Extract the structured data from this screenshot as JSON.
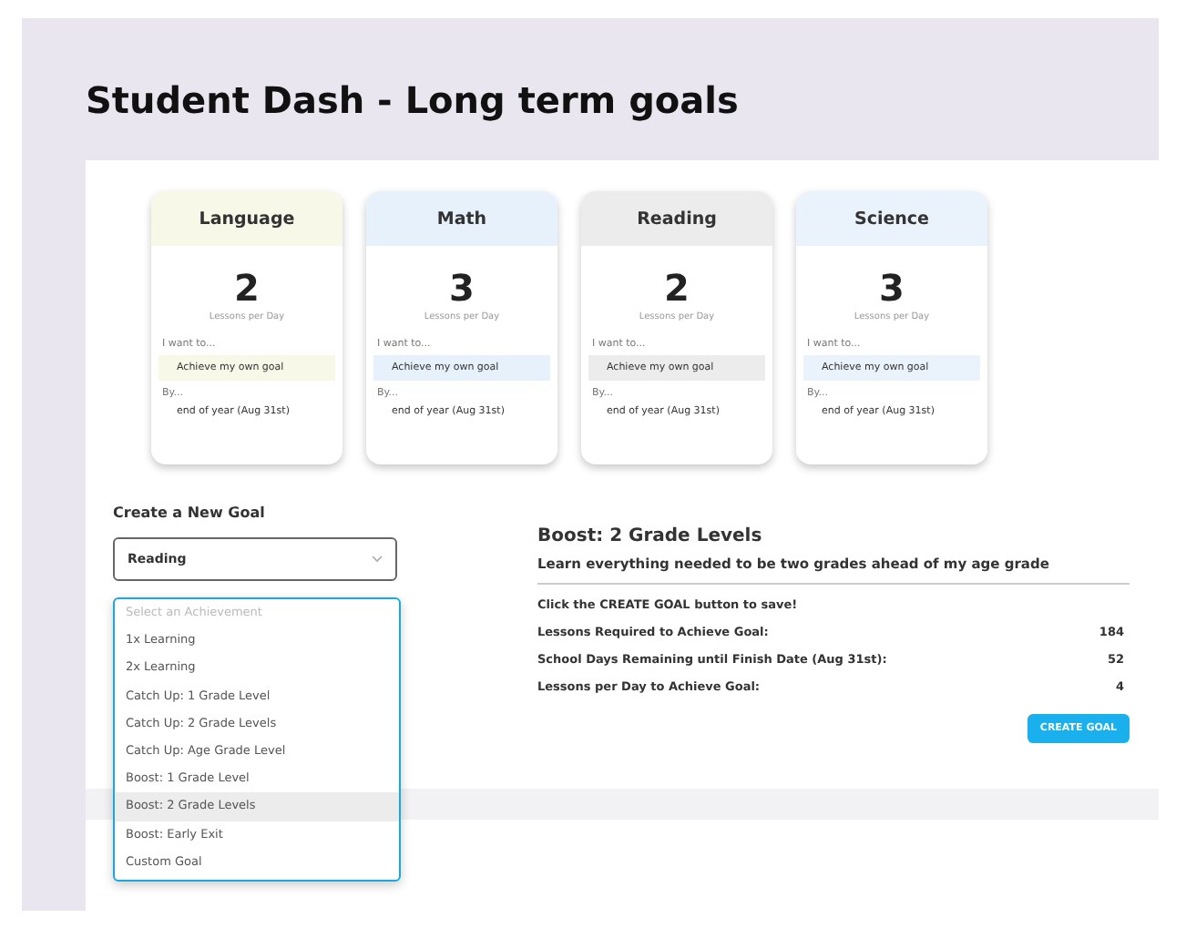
{
  "title": "Student Dash - Long term goals",
  "subjects": [
    {
      "name": "Language",
      "color": "#f8f8e8",
      "count": "2",
      "unit": "Lessons per Day",
      "want_label": "I want to...",
      "goal": "Achieve my own goal",
      "by_label": "By...",
      "deadline": "end of year (Aug 31st)"
    },
    {
      "name": "Math",
      "color": "#e6f1fb",
      "count": "3",
      "unit": "Lessons per Day",
      "want_label": "I want to...",
      "goal": "Achieve my own goal",
      "by_label": "By...",
      "deadline": "end of year (Aug 31st)"
    },
    {
      "name": "Reading",
      "color": "#ececec",
      "count": "2",
      "unit": "Lessons per Day",
      "want_label": "I want to...",
      "goal": "Achieve my own goal",
      "by_label": "By...",
      "deadline": "end of year (Aug 31st)"
    },
    {
      "name": "Science",
      "color": "#eaf2fc",
      "count": "3",
      "unit": "Lessons per Day",
      "want_label": "I want to...",
      "goal": "Achieve my own goal",
      "by_label": "By...",
      "deadline": "end of year (Aug 31st)"
    }
  ],
  "new_goal": {
    "heading": "Create a New Goal",
    "subject_select": {
      "value": "Reading"
    },
    "achievement_select": {
      "placeholder": "Select an Achievement",
      "options": [
        {
          "label": "1x Learning",
          "selected": false
        },
        {
          "label": "2x Learning",
          "selected": false
        },
        {
          "label": "Catch Up: 1 Grade Level",
          "selected": false
        },
        {
          "label": "Catch Up: 2 Grade Levels",
          "selected": false
        },
        {
          "label": "Catch Up: Age Grade Level",
          "selected": false
        },
        {
          "label": "Boost: 1 Grade Level",
          "selected": false
        },
        {
          "label": "Boost: 2 Grade Levels",
          "selected": true
        },
        {
          "label": "Boost: Early Exit",
          "selected": false
        },
        {
          "label": "Custom Goal",
          "selected": false
        }
      ]
    }
  },
  "summary": {
    "title": "Boost: 2 Grade Levels",
    "description": "Learn everything needed to be two grades ahead of my age grade",
    "hint": "Click the CREATE GOAL button to save!",
    "stats": [
      {
        "label": "Lessons Required to Achieve Goal:",
        "value": "184"
      },
      {
        "label": "School Days Remaining until Finish Date (Aug 31st):",
        "value": "52"
      },
      {
        "label": "Lessons per Day to Achieve Goal:",
        "value": "4"
      }
    ],
    "button": "CREATE GOAL"
  }
}
